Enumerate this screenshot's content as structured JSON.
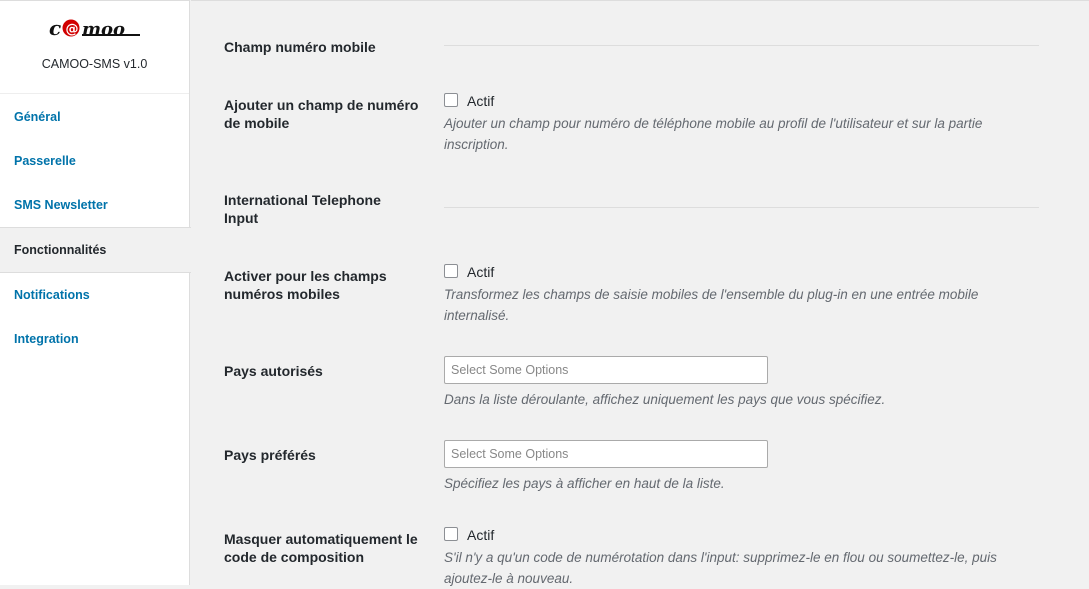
{
  "sidebar": {
    "logo_text": "c@moo",
    "version": "CAMOO-SMS v1.0",
    "items": [
      {
        "label": "Général"
      },
      {
        "label": "Passerelle"
      },
      {
        "label": "SMS Newsletter"
      },
      {
        "label": "Fonctionnalités"
      },
      {
        "label": "Notifications"
      },
      {
        "label": "Integration"
      }
    ]
  },
  "main": {
    "section_mobile": {
      "title": "Champ numéro mobile"
    },
    "add_mobile_field": {
      "label": "Ajouter un champ de numéro de mobile",
      "checkbox_label": "Actif",
      "description": "Ajouter un champ pour numéro de téléphone mobile au profil de l'utilisateur et sur la partie inscription."
    },
    "section_intl": {
      "title": "International Telephone Input"
    },
    "enable_intl": {
      "label": "Activer pour les champs numéros mobiles",
      "checkbox_label": "Actif",
      "description": "Transformez les champs de saisie mobiles de l'ensemble du plug-in en une entrée mobile internalisé."
    },
    "allowed_countries": {
      "label": "Pays autorisés",
      "placeholder": "Select Some Options",
      "description": "Dans la liste déroulante, affichez uniquement les pays que vous spécifiez."
    },
    "preferred_countries": {
      "label": "Pays préférés",
      "placeholder": "Select Some Options",
      "description": "Spécifiez les pays à afficher en haut de la liste."
    },
    "auto_hide_dial": {
      "label": "Masquer automatiquement le code de composition",
      "checkbox_label": "Actif",
      "description": "S'il n'y a qu'un code de numérotation dans l'input: supprimez-le en flou ou soumettez-le, puis ajoutez-le à nouveau."
    }
  }
}
